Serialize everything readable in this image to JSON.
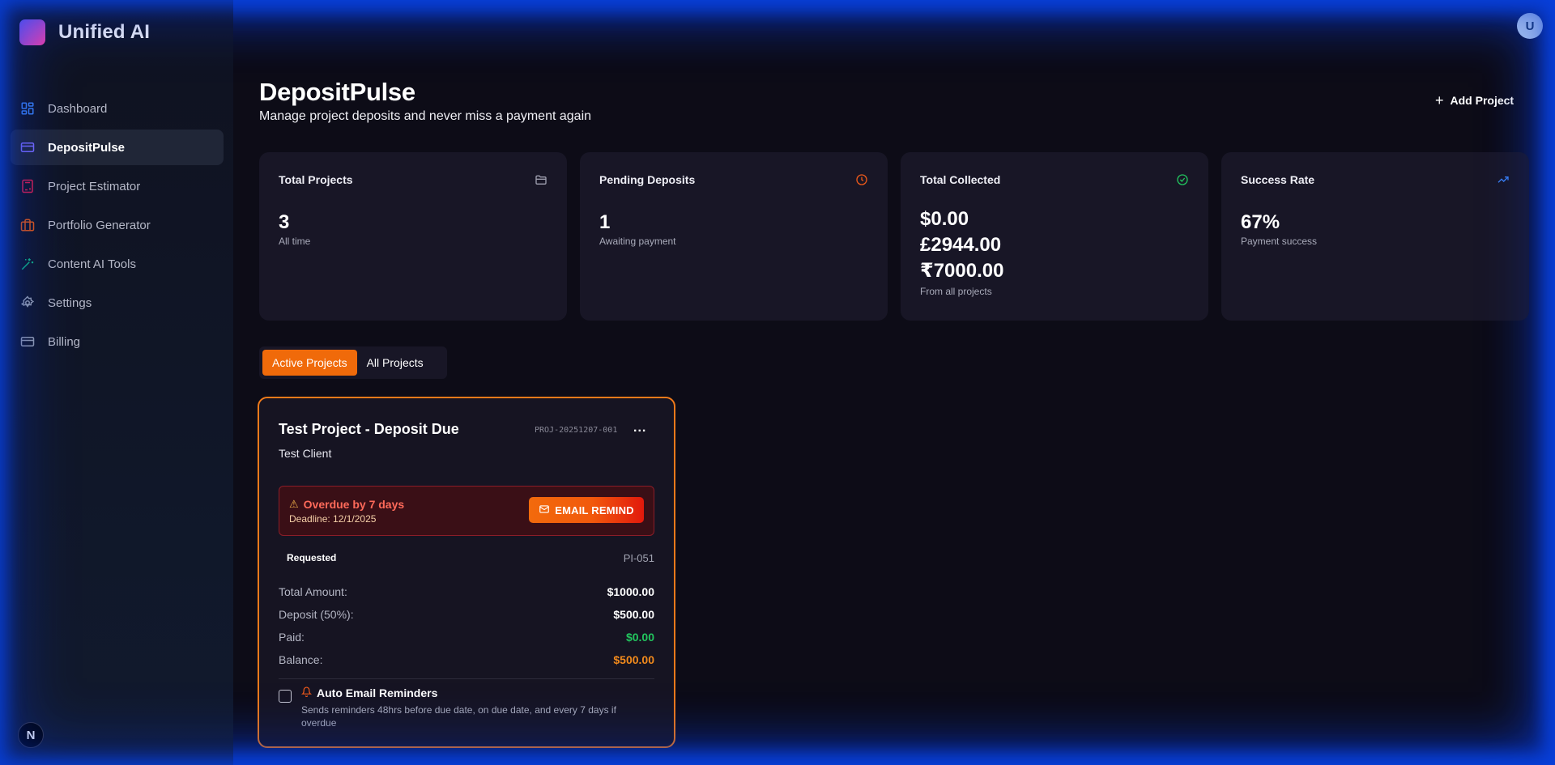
{
  "brand": {
    "name": "Unified AI"
  },
  "user": {
    "avatar_letter": "U"
  },
  "sidebar": {
    "items": [
      {
        "label": "Dashboard",
        "icon": "grid-icon",
        "color": "#3b82f6"
      },
      {
        "label": "DepositPulse",
        "icon": "card-icon",
        "color": "#7c6cff"
      },
      {
        "label": "Project Estimator",
        "icon": "calculator-icon",
        "color": "#e11d48"
      },
      {
        "label": "Portfolio Generator",
        "icon": "briefcase-icon",
        "color": "#ea580c"
      },
      {
        "label": "Content AI Tools",
        "icon": "wand-icon",
        "color": "#10b981"
      },
      {
        "label": "Settings",
        "icon": "gear-icon",
        "color": "#9ca3af"
      },
      {
        "label": "Billing",
        "icon": "card-icon",
        "color": "#9ca3af"
      }
    ],
    "footer_badge": "N"
  },
  "header": {
    "title": "DepositPulse",
    "subtitle": "Manage project deposits and never miss a payment again",
    "add_label": "Add Project"
  },
  "stats": [
    {
      "label": "Total Projects",
      "value": "3",
      "caption": "All time",
      "icon": "folder-icon",
      "color": "#a0a0b0"
    },
    {
      "label": "Pending Deposits",
      "value": "1",
      "caption": "Awaiting payment",
      "icon": "clock-icon",
      "color": "#f05a1a"
    },
    {
      "label": "Total Collected",
      "values": [
        "$0.00",
        "£2944.00",
        "₹7000.00"
      ],
      "caption": "From all projects",
      "icon": "check-circle-icon",
      "color": "#22c55e"
    },
    {
      "label": "Success Rate",
      "value": "67%",
      "caption": "Payment success",
      "icon": "trending-up-icon",
      "color": "#3b82f6"
    }
  ],
  "tabs": [
    {
      "label": "Active Projects",
      "active": true
    },
    {
      "label": "All Projects",
      "active": false
    }
  ],
  "project": {
    "title": "Test Project - Deposit Due",
    "id": "PROJ-20251207-001",
    "more": "...",
    "client": "Test Client",
    "alert_title": "Overdue by 7 days",
    "deadline": "Deadline: 12/1/2025",
    "remind_label": "EMAIL REMIND",
    "status": "Requested",
    "invoice": "PI-051",
    "rows": [
      {
        "k": "Total Amount:",
        "v": "$1000.00"
      },
      {
        "k": "Deposit (50%):",
        "v": "$500.00"
      },
      {
        "k": "Paid:",
        "v": "$0.00"
      },
      {
        "k": "Balance:",
        "v": "$500.00"
      }
    ],
    "auto_title": "Auto Email Reminders",
    "auto_desc": "Sends reminders 48hrs before due date, on due date, and every 7 days if overdue"
  }
}
